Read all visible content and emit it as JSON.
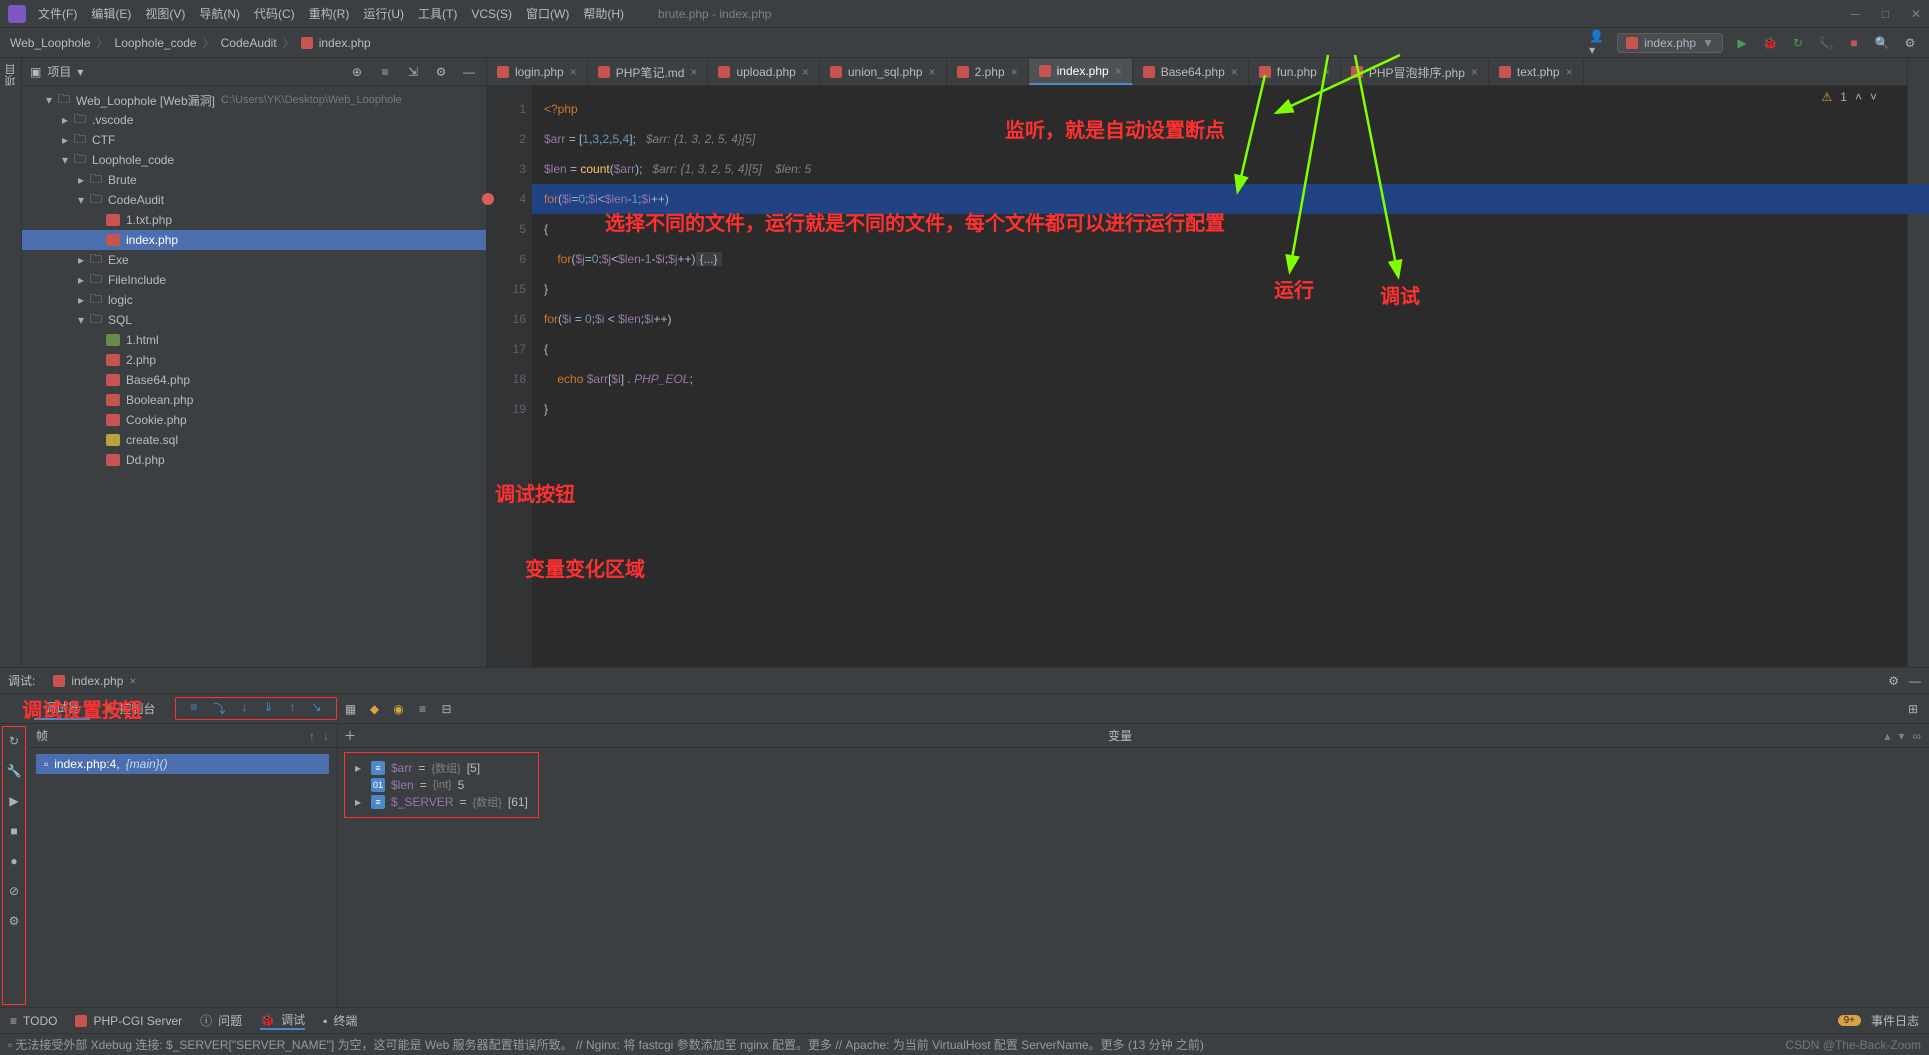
{
  "menubar": {
    "items": [
      "文件(F)",
      "编辑(E)",
      "视图(V)",
      "导航(N)",
      "代码(C)",
      "重构(R)",
      "运行(U)",
      "工具(T)",
      "VCS(S)",
      "窗口(W)",
      "帮助(H)"
    ],
    "title": "brute.php - index.php"
  },
  "breadcrumb": [
    "Web_Loophole",
    "Loophole_code",
    "CodeAudit",
    "index.php"
  ],
  "run_config": "index.php",
  "project": {
    "title": "项目",
    "root": {
      "name": "Web_Loophole [Web漏洞]",
      "hint": "C:\\Users\\YK\\Desktop\\Web_Loophole"
    },
    "nodes": [
      {
        "indent": 1,
        "arrow": "▾",
        "type": "folder",
        "name": "Web_Loophole [Web漏洞]",
        "hint": "C:\\Users\\YK\\Desktop\\Web_Loophole"
      },
      {
        "indent": 2,
        "arrow": "▸",
        "type": "folder",
        "name": ".vscode"
      },
      {
        "indent": 2,
        "arrow": "▸",
        "type": "folder",
        "name": "CTF"
      },
      {
        "indent": 2,
        "arrow": "▾",
        "type": "folder",
        "name": "Loophole_code"
      },
      {
        "indent": 3,
        "arrow": "▸",
        "type": "folder",
        "name": "Brute"
      },
      {
        "indent": 3,
        "arrow": "▾",
        "type": "folder",
        "name": "CodeAudit"
      },
      {
        "indent": 4,
        "arrow": "",
        "type": "php",
        "name": "1.txt.php"
      },
      {
        "indent": 4,
        "arrow": "",
        "type": "php",
        "name": "index.php",
        "selected": true
      },
      {
        "indent": 3,
        "arrow": "▸",
        "type": "folder",
        "name": "Exe"
      },
      {
        "indent": 3,
        "arrow": "▸",
        "type": "folder",
        "name": "FileInclude"
      },
      {
        "indent": 3,
        "arrow": "▸",
        "type": "folder",
        "name": "logic"
      },
      {
        "indent": 3,
        "arrow": "▾",
        "type": "folder",
        "name": "SQL"
      },
      {
        "indent": 4,
        "arrow": "",
        "type": "file",
        "name": "1.html"
      },
      {
        "indent": 4,
        "arrow": "",
        "type": "php",
        "name": "2.php"
      },
      {
        "indent": 4,
        "arrow": "",
        "type": "php",
        "name": "Base64.php"
      },
      {
        "indent": 4,
        "arrow": "",
        "type": "php",
        "name": "Boolean.php"
      },
      {
        "indent": 4,
        "arrow": "",
        "type": "php",
        "name": "Cookie.php"
      },
      {
        "indent": 4,
        "arrow": "",
        "type": "sql",
        "name": "create.sql"
      },
      {
        "indent": 4,
        "arrow": "",
        "type": "php",
        "name": "Dd.php"
      }
    ]
  },
  "editor_tabs": [
    {
      "name": "login.php"
    },
    {
      "name": "PHP笔记.md"
    },
    {
      "name": "upload.php"
    },
    {
      "name": "union_sql.php"
    },
    {
      "name": "2.php"
    },
    {
      "name": "index.php",
      "active": true
    },
    {
      "name": "Base64.php"
    },
    {
      "name": "fun.php"
    },
    {
      "name": "PHP冒泡排序.php"
    },
    {
      "name": "text.php"
    }
  ],
  "inspection": {
    "warn": "1"
  },
  "code": {
    "lines": [
      "1",
      "2",
      "3",
      "4",
      "5",
      "6",
      "15",
      "16",
      "17",
      "18",
      "19"
    ],
    "l1": "<?php",
    "l2_cmt": "$arr: {1, 3, 2, 5, 4}[5]",
    "l3_cmt1": "$arr: {1, 3, 2, 5, 4}[5]",
    "l3_cmt2": "$len: 5",
    "fold": "{...}"
  },
  "annotations": {
    "listen": "监听，就是自动设置断点",
    "file_select": "选择不同的文件，运行就是不同的文件，每个文件都可以进行运行配置",
    "run": "运行",
    "debug": "调试",
    "debug_buttons": "调试按钮",
    "var_area": "变量变化区域",
    "debug_settings": "调试设置按钮"
  },
  "debug": {
    "tab_label": "调试:",
    "file": "index.php",
    "tabs": {
      "debugger": "调试器",
      "console": "控制台"
    },
    "frames_hdr": "帧",
    "vars_hdr": "变量",
    "frame": {
      "file": "index.php:4,",
      "func": "{main}()"
    },
    "vars": [
      {
        "arrow": "▸",
        "ico": "≡",
        "name": "$arr",
        "eq": "=",
        "type": "{数组}",
        "val": "[5]"
      },
      {
        "arrow": "",
        "ico": "01",
        "name": "$len",
        "eq": "=",
        "type": "{int}",
        "val": "5"
      },
      {
        "arrow": "▸",
        "ico": "≡",
        "name": "$_SERVER",
        "eq": "=",
        "type": "{数组}",
        "val": "[61]"
      }
    ]
  },
  "tool_windows": {
    "items": [
      "TODO",
      "PHP-CGI Server",
      "问题",
      "调试",
      "终端"
    ],
    "event_log": "事件日志"
  },
  "statusbar": {
    "msg": "无法接受外部 Xdebug 连接: $_SERVER[\"SERVER_NAME\"] 为空，这可能是 Web 服务器配置错误所致。 // Nginx: 将 fastcgi 参数添加至 nginx 配置。更多 // Apache: 为当前 VirtualHost 配置 ServerName。更多 (13 分钟 之前)",
    "watermark": "CSDN @The-Back-Zoom"
  }
}
